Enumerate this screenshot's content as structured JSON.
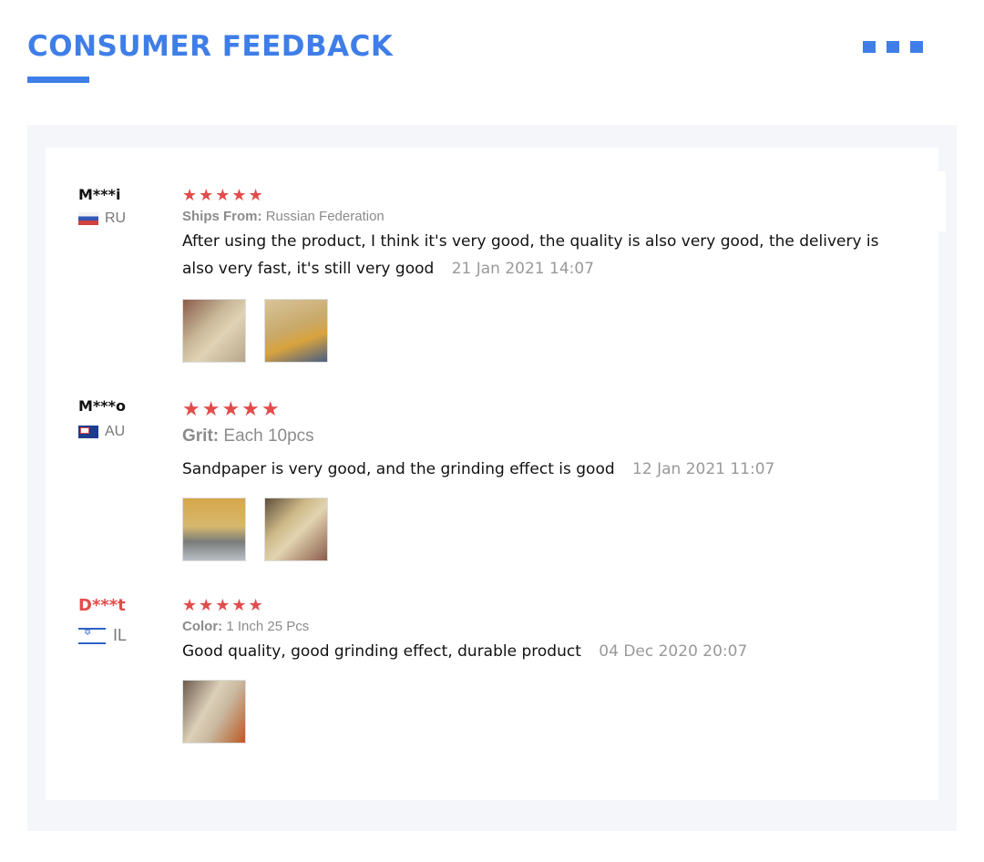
{
  "header": {
    "title": "CONSUMER FEEDBACK",
    "menu_icon": "three-squares-icon"
  },
  "colors": {
    "accent": "#3f7ee8",
    "star": "#e24c4b",
    "panel": "#f4f6fa"
  },
  "reviews": [
    {
      "user": "M***i",
      "country": "RU",
      "stars": "★★★★★",
      "rating": 5,
      "meta_label": "Ships From:",
      "meta_value": "Russian Federation",
      "text": "After using the product, I think it's very good, the quality is also very good, the delivery is also very fast, it's still very good",
      "date": "21 Jan 2021 14:07",
      "photos": 2
    },
    {
      "user": "M***o",
      "country": "AU",
      "stars": "★★★★★",
      "rating": 5,
      "meta_label": "Grit:",
      "meta_value": "Each 10pcs",
      "text": "Sandpaper is very good, and the grinding effect is good",
      "date": "12 Jan 2021 11:07",
      "photos": 2
    },
    {
      "user": "D***t",
      "country": "IL",
      "stars": "★★★★★",
      "rating": 5,
      "meta_label": "Color:",
      "meta_value": "1 Inch 25 Pcs",
      "text": "Good quality, good grinding effect, durable product",
      "date": "04 Dec 2020 20:07",
      "photos": 1
    }
  ]
}
